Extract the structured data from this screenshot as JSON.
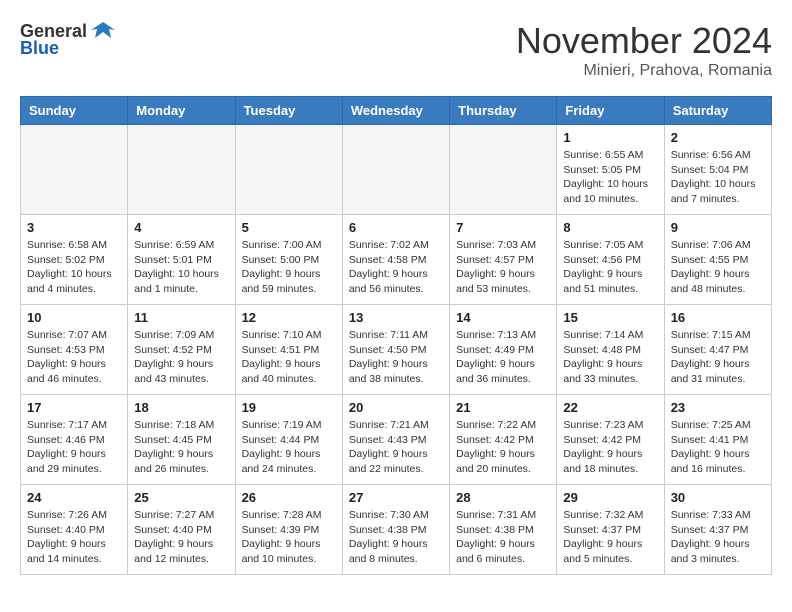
{
  "logo": {
    "general": "General",
    "blue": "Blue"
  },
  "title": "November 2024",
  "location": "Minieri, Prahova, Romania",
  "headers": [
    "Sunday",
    "Monday",
    "Tuesday",
    "Wednesday",
    "Thursday",
    "Friday",
    "Saturday"
  ],
  "weeks": [
    [
      {
        "day": "",
        "info": ""
      },
      {
        "day": "",
        "info": ""
      },
      {
        "day": "",
        "info": ""
      },
      {
        "day": "",
        "info": ""
      },
      {
        "day": "",
        "info": ""
      },
      {
        "day": "1",
        "info": "Sunrise: 6:55 AM\nSunset: 5:05 PM\nDaylight: 10 hours and 10 minutes."
      },
      {
        "day": "2",
        "info": "Sunrise: 6:56 AM\nSunset: 5:04 PM\nDaylight: 10 hours and 7 minutes."
      }
    ],
    [
      {
        "day": "3",
        "info": "Sunrise: 6:58 AM\nSunset: 5:02 PM\nDaylight: 10 hours and 4 minutes."
      },
      {
        "day": "4",
        "info": "Sunrise: 6:59 AM\nSunset: 5:01 PM\nDaylight: 10 hours and 1 minute."
      },
      {
        "day": "5",
        "info": "Sunrise: 7:00 AM\nSunset: 5:00 PM\nDaylight: 9 hours and 59 minutes."
      },
      {
        "day": "6",
        "info": "Sunrise: 7:02 AM\nSunset: 4:58 PM\nDaylight: 9 hours and 56 minutes."
      },
      {
        "day": "7",
        "info": "Sunrise: 7:03 AM\nSunset: 4:57 PM\nDaylight: 9 hours and 53 minutes."
      },
      {
        "day": "8",
        "info": "Sunrise: 7:05 AM\nSunset: 4:56 PM\nDaylight: 9 hours and 51 minutes."
      },
      {
        "day": "9",
        "info": "Sunrise: 7:06 AM\nSunset: 4:55 PM\nDaylight: 9 hours and 48 minutes."
      }
    ],
    [
      {
        "day": "10",
        "info": "Sunrise: 7:07 AM\nSunset: 4:53 PM\nDaylight: 9 hours and 46 minutes."
      },
      {
        "day": "11",
        "info": "Sunrise: 7:09 AM\nSunset: 4:52 PM\nDaylight: 9 hours and 43 minutes."
      },
      {
        "day": "12",
        "info": "Sunrise: 7:10 AM\nSunset: 4:51 PM\nDaylight: 9 hours and 40 minutes."
      },
      {
        "day": "13",
        "info": "Sunrise: 7:11 AM\nSunset: 4:50 PM\nDaylight: 9 hours and 38 minutes."
      },
      {
        "day": "14",
        "info": "Sunrise: 7:13 AM\nSunset: 4:49 PM\nDaylight: 9 hours and 36 minutes."
      },
      {
        "day": "15",
        "info": "Sunrise: 7:14 AM\nSunset: 4:48 PM\nDaylight: 9 hours and 33 minutes."
      },
      {
        "day": "16",
        "info": "Sunrise: 7:15 AM\nSunset: 4:47 PM\nDaylight: 9 hours and 31 minutes."
      }
    ],
    [
      {
        "day": "17",
        "info": "Sunrise: 7:17 AM\nSunset: 4:46 PM\nDaylight: 9 hours and 29 minutes."
      },
      {
        "day": "18",
        "info": "Sunrise: 7:18 AM\nSunset: 4:45 PM\nDaylight: 9 hours and 26 minutes."
      },
      {
        "day": "19",
        "info": "Sunrise: 7:19 AM\nSunset: 4:44 PM\nDaylight: 9 hours and 24 minutes."
      },
      {
        "day": "20",
        "info": "Sunrise: 7:21 AM\nSunset: 4:43 PM\nDaylight: 9 hours and 22 minutes."
      },
      {
        "day": "21",
        "info": "Sunrise: 7:22 AM\nSunset: 4:42 PM\nDaylight: 9 hours and 20 minutes."
      },
      {
        "day": "22",
        "info": "Sunrise: 7:23 AM\nSunset: 4:42 PM\nDaylight: 9 hours and 18 minutes."
      },
      {
        "day": "23",
        "info": "Sunrise: 7:25 AM\nSunset: 4:41 PM\nDaylight: 9 hours and 16 minutes."
      }
    ],
    [
      {
        "day": "24",
        "info": "Sunrise: 7:26 AM\nSunset: 4:40 PM\nDaylight: 9 hours and 14 minutes."
      },
      {
        "day": "25",
        "info": "Sunrise: 7:27 AM\nSunset: 4:40 PM\nDaylight: 9 hours and 12 minutes."
      },
      {
        "day": "26",
        "info": "Sunrise: 7:28 AM\nSunset: 4:39 PM\nDaylight: 9 hours and 10 minutes."
      },
      {
        "day": "27",
        "info": "Sunrise: 7:30 AM\nSunset: 4:38 PM\nDaylight: 9 hours and 8 minutes."
      },
      {
        "day": "28",
        "info": "Sunrise: 7:31 AM\nSunset: 4:38 PM\nDaylight: 9 hours and 6 minutes."
      },
      {
        "day": "29",
        "info": "Sunrise: 7:32 AM\nSunset: 4:37 PM\nDaylight: 9 hours and 5 minutes."
      },
      {
        "day": "30",
        "info": "Sunrise: 7:33 AM\nSunset: 4:37 PM\nDaylight: 9 hours and 3 minutes."
      }
    ]
  ]
}
